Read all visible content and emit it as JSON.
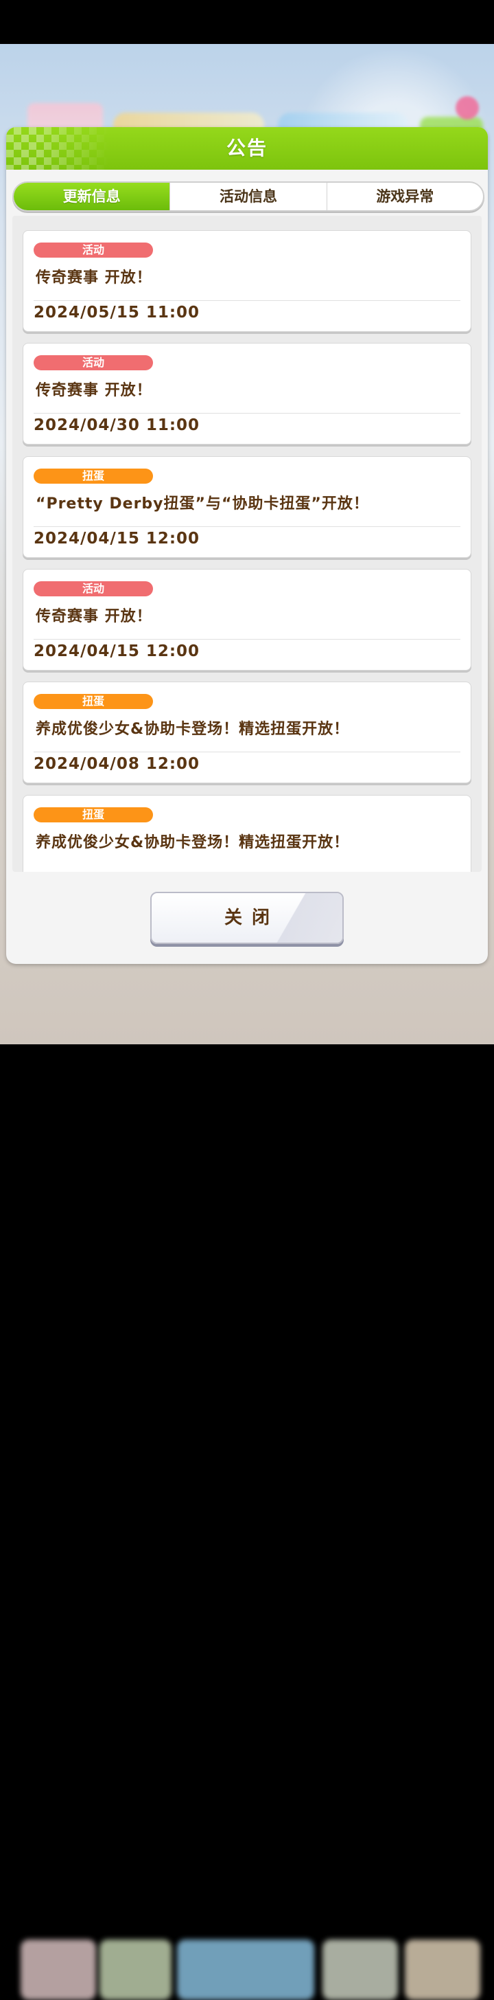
{
  "dialog": {
    "title": "公告",
    "tabs": [
      {
        "label": "更新信息",
        "active": true
      },
      {
        "label": "活动信息",
        "active": false
      },
      {
        "label": "游戏异常",
        "active": false
      }
    ],
    "items": [
      {
        "badge": "活动",
        "badge_color": "#f06d70",
        "title": "传奇赛事 开放！",
        "date": "2024/05/15 11:00"
      },
      {
        "badge": "活动",
        "badge_color": "#f06d70",
        "title": "传奇赛事 开放！",
        "date": "2024/04/30 11:00"
      },
      {
        "badge": "扭蛋",
        "badge_color": "#fd9417",
        "title": "“Pretty Derby扭蛋”与“协助卡扭蛋”开放！",
        "date": "2024/04/15 12:00"
      },
      {
        "badge": "活动",
        "badge_color": "#f06d70",
        "title": "传奇赛事 开放！",
        "date": "2024/04/15 12:00"
      },
      {
        "badge": "扭蛋",
        "badge_color": "#fd9417",
        "title": "养成优俊少女&协助卡登场！精选扭蛋开放！",
        "date": "2024/04/08 12:00"
      },
      {
        "badge": "扭蛋",
        "badge_color": "#fd9417",
        "title": "养成优俊少女&协助卡登场！精选扭蛋开放！",
        "date": ""
      }
    ],
    "close_label": "关闭"
  },
  "colors": {
    "header_green": "#7dc40d",
    "text_brown": "#5a3512",
    "badge_event": "#f06d70",
    "badge_gacha": "#fd9417"
  }
}
